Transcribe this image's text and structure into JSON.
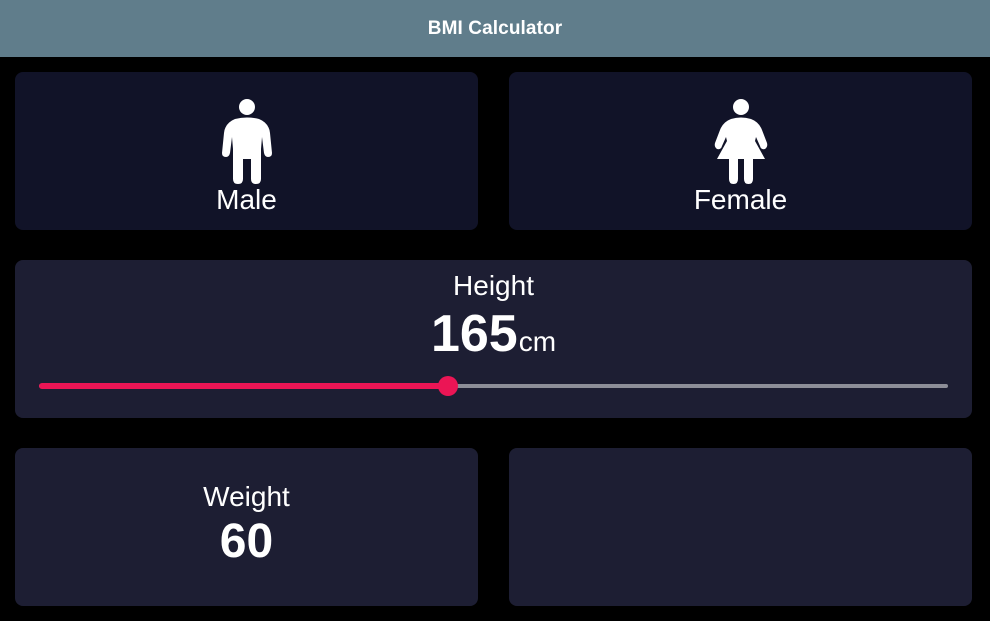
{
  "app_bar": {
    "title": "BMI Calculator"
  },
  "colors": {
    "app_bar": "#607d8b",
    "background": "#000000",
    "card_active": "#1d1e33",
    "card_inactive": "#111328",
    "slider_active": "#eb1555",
    "slider_inactive": "#8d8e98",
    "text": "#ffffff"
  },
  "gender": {
    "male": {
      "label": "Male",
      "icon": "male-person-icon"
    },
    "female": {
      "label": "Female",
      "icon": "female-person-icon"
    }
  },
  "height": {
    "label": "Height",
    "value": "165",
    "unit": "cm",
    "slider_fraction": 0.45
  },
  "weight": {
    "label": "Weight",
    "value": "60"
  }
}
